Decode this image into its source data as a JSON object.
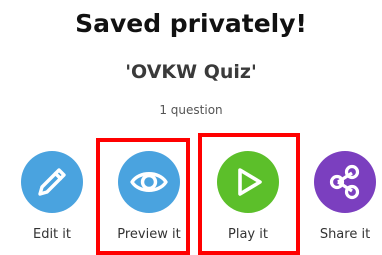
{
  "header": {
    "title": "Saved privately!",
    "quiz_name": "'OVKW Quiz'",
    "question_count": "1 question"
  },
  "actions": [
    {
      "label": "Edit it",
      "icon": "pencil-icon",
      "color": "#4aa3df"
    },
    {
      "label": "Preview it",
      "icon": "eye-icon",
      "color": "#4aa3df"
    },
    {
      "label": "Play it",
      "icon": "play-icon",
      "color": "#5cbf2a"
    },
    {
      "label": "Share it",
      "icon": "share-icon",
      "color": "#7b3fbf"
    }
  ],
  "highlight_color": "#ff0000"
}
